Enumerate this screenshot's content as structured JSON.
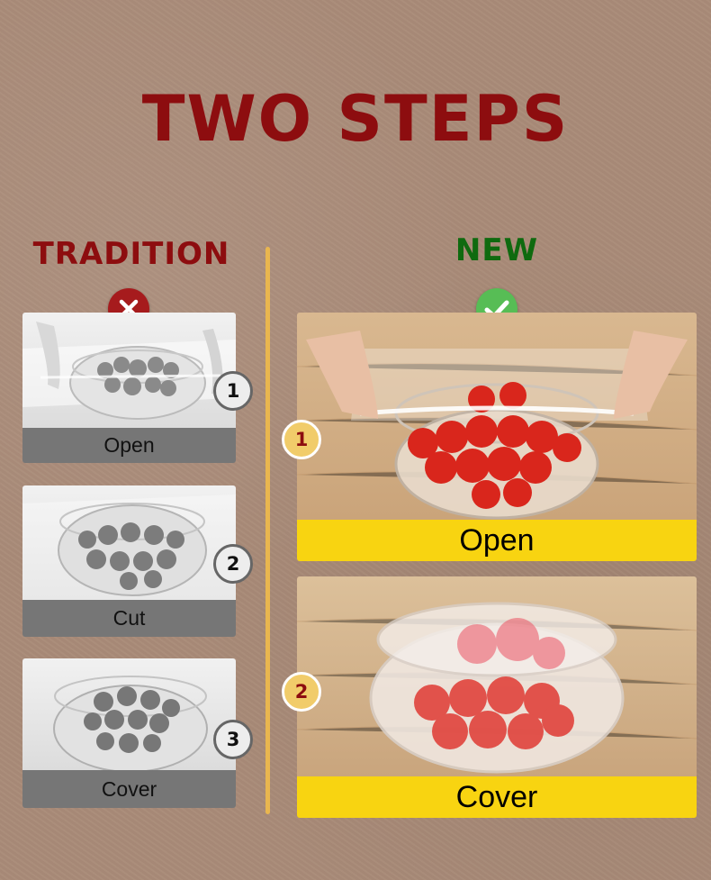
{
  "title": "TWO STEPS",
  "columns": {
    "tradition": {
      "heading": "TRADITION",
      "mark_icon": "x-circle-icon",
      "steps": [
        {
          "number": "1",
          "label": "Open"
        },
        {
          "number": "2",
          "label": "Cut"
        },
        {
          "number": "3",
          "label": "Cover"
        }
      ]
    },
    "new": {
      "heading": "NEW",
      "mark_icon": "check-circle-icon",
      "steps": [
        {
          "number": "1",
          "label": "Open"
        },
        {
          "number": "2",
          "label": "Cover"
        }
      ]
    }
  },
  "colors": {
    "background": "#a98b78",
    "title": "#8d0d0f",
    "new_heading": "#0f6a0f",
    "divider": "#e9b64f",
    "new_label_bar": "#f8d411",
    "tradition_label_bar": "#767676"
  }
}
